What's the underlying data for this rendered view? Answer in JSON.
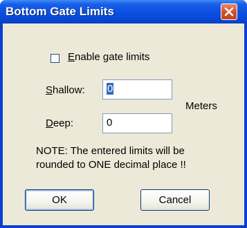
{
  "window": {
    "title": "Bottom Gate Limits"
  },
  "icons": {
    "close": "close-icon"
  },
  "enable_checkbox": {
    "label_prefix": "",
    "label_accel": "E",
    "label_rest": "nable gate limits",
    "checked": false
  },
  "shallow": {
    "label_accel": "S",
    "label_rest": "hallow:",
    "value": "0"
  },
  "deep": {
    "label_accel": "D",
    "label_rest": "eep:",
    "value": "0"
  },
  "units": "Meters",
  "note": {
    "line1": "NOTE:  The entered limits will be",
    "line2": "rounded to ONE decimal place !!"
  },
  "buttons": {
    "ok": "OK",
    "cancel": "Cancel"
  },
  "colors": {
    "titlebar": "#0a50e0",
    "client": "#ece9d8",
    "close": "#d2512c"
  }
}
